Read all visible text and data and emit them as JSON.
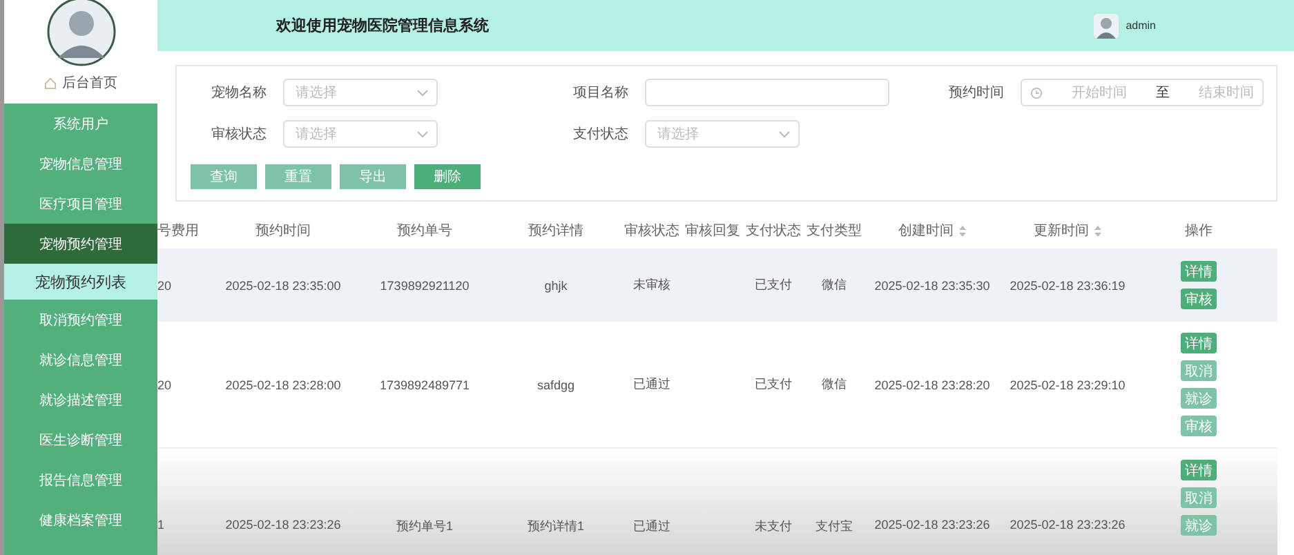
{
  "sidebar": {
    "home": "后台首页",
    "items": [
      {
        "label": "系统用户",
        "selected": false,
        "expanded": false
      },
      {
        "label": "宠物信息管理",
        "selected": false,
        "expanded": false
      },
      {
        "label": "医疗项目管理",
        "selected": false,
        "expanded": false
      },
      {
        "label": "宠物预约管理",
        "selected": false,
        "expanded": true,
        "children": [
          {
            "label": "宠物预约列表",
            "selected": true
          }
        ]
      },
      {
        "label": "取消预约管理",
        "selected": false,
        "expanded": false
      },
      {
        "label": "就诊信息管理",
        "selected": false,
        "expanded": false
      },
      {
        "label": "就诊描述管理",
        "selected": false,
        "expanded": false
      },
      {
        "label": "医生诊断管理",
        "selected": false,
        "expanded": false
      },
      {
        "label": "报告信息管理",
        "selected": false,
        "expanded": false
      },
      {
        "label": "健康档案管理",
        "selected": false,
        "expanded": false
      }
    ]
  },
  "header": {
    "title": "欢迎使用宠物医院管理信息系统",
    "user": "admin"
  },
  "search": {
    "fields": [
      {
        "kind": "select",
        "label": "宠物名称",
        "placeholder": "请选择"
      },
      {
        "kind": "input",
        "label": "项目名称"
      },
      {
        "kind": "daterange",
        "label": "预约时间",
        "start_placeholder": "开始时间",
        "separator": "至",
        "end_placeholder": "结束时间"
      },
      {
        "kind": "select",
        "label": "审核状态",
        "placeholder": "请选择"
      },
      {
        "kind": "select",
        "label": "支付状态",
        "placeholder": "请选择"
      }
    ],
    "buttons": [
      {
        "label": "查询",
        "kind": "light"
      },
      {
        "label": "重置",
        "kind": "light"
      },
      {
        "label": "导出",
        "kind": "light"
      },
      {
        "label": "删除",
        "kind": "primary"
      }
    ]
  },
  "table": {
    "columns": [
      {
        "label": "号费用",
        "sortable": false
      },
      {
        "label": "预约时间",
        "sortable": false
      },
      {
        "label": "预约单号",
        "sortable": false
      },
      {
        "label": "预约详情",
        "sortable": false
      },
      {
        "label": "审核状态",
        "sortable": false
      },
      {
        "label": "审核回复",
        "sortable": false
      },
      {
        "label": "支付状态",
        "sortable": false
      },
      {
        "label": "支付类型",
        "sortable": false
      },
      {
        "label": "创建时间",
        "sortable": true
      },
      {
        "label": "更新时间",
        "sortable": true
      },
      {
        "label": "操作",
        "sortable": false
      }
    ],
    "rows": [
      {
        "highlighted": true,
        "cells": [
          "20",
          "2025-02-18 23:35:00",
          "1739892921120",
          "ghjk",
          "未审核",
          "",
          "已支付",
          "微信",
          "2025-02-18 23:35:30",
          "2025-02-18 23:36:19"
        ],
        "actions": [
          {
            "label": "详情",
            "kind": "primary"
          },
          {
            "label": "审核",
            "kind": "primary"
          }
        ]
      },
      {
        "highlighted": false,
        "cells": [
          "20",
          "2025-02-18 23:28:00",
          "1739892489771",
          "safdgg",
          "已通过",
          "",
          "已支付",
          "微信",
          "2025-02-18 23:28:20",
          "2025-02-18 23:29:10"
        ],
        "actions": [
          {
            "label": "详情",
            "kind": "primary"
          },
          {
            "label": "取消",
            "kind": "light"
          },
          {
            "label": "就诊",
            "kind": "light"
          },
          {
            "label": "审核",
            "kind": "light"
          }
        ]
      },
      {
        "highlighted": false,
        "cells": [
          "1",
          "2025-02-18 23:23:26",
          "预约单号1",
          "预约详情1",
          "已通过",
          "",
          "未支付",
          "支付宝",
          "2025-02-18 23:23:26",
          "2025-02-18 23:23:26"
        ],
        "actions": [
          {
            "label": "详情",
            "kind": "primary"
          },
          {
            "label": "取消",
            "kind": "light"
          },
          {
            "label": "就诊",
            "kind": "light"
          }
        ]
      }
    ]
  }
}
